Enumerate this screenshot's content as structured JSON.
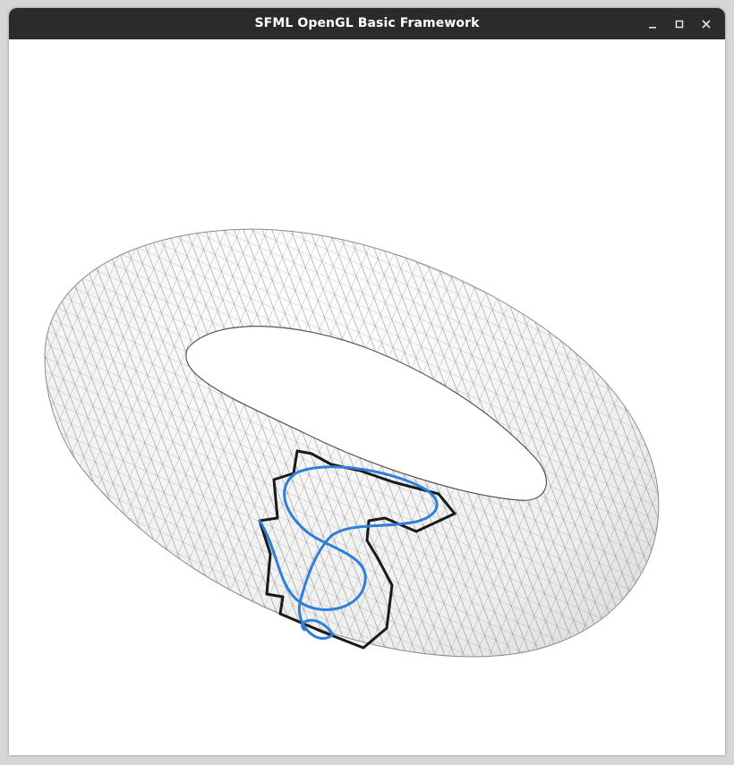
{
  "window": {
    "title": "SFML OpenGL Basic Framework"
  },
  "controls": {
    "minimize_icon": "minimize-icon",
    "maximize_icon": "maximize-icon",
    "close_icon": "close-icon"
  },
  "scene": {
    "background": "#ffffff",
    "mesh_fill": "#f2f2f2",
    "wire_color": "#6f6f6f",
    "path_black": "#1a1a1a",
    "path_blue": "#2e7fd8"
  }
}
